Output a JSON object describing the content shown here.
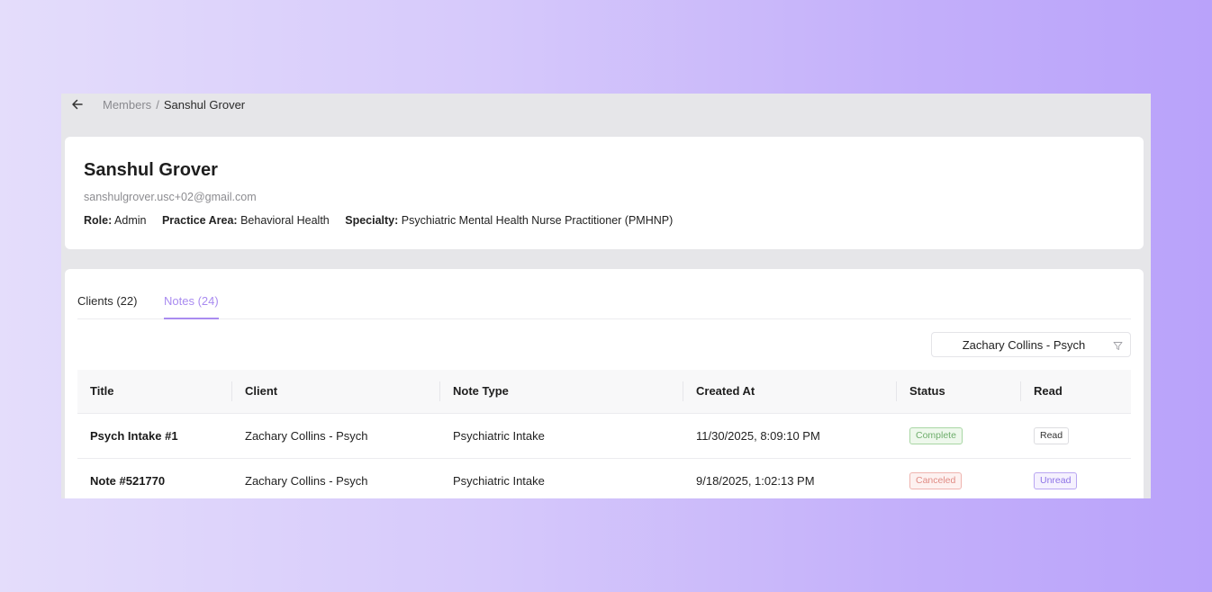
{
  "breadcrumb": {
    "back_icon": "arrow-left-icon",
    "parent": "Members",
    "separator": "/",
    "current": "Sanshul Grover"
  },
  "profile": {
    "name": "Sanshul Grover",
    "email": "sanshulgrover.usc+02@gmail.com",
    "role_label": "Role:",
    "role": "Admin",
    "practice_area_label": "Practice Area:",
    "practice_area": "Behavioral Health",
    "specialty_label": "Specialty:",
    "specialty": "Psychiatric Mental Health Nurse Practitioner (PMHNP)"
  },
  "tabs": [
    {
      "label": "Clients (22)",
      "active": false
    },
    {
      "label": "Notes (24)",
      "active": true
    }
  ],
  "filter": {
    "value": "Zachary Collins - Psych",
    "icon": "filter-icon"
  },
  "table": {
    "columns": [
      "Title",
      "Client",
      "Note Type",
      "Created At",
      "Status",
      "Read"
    ],
    "rows": [
      {
        "title": "Psych Intake #1",
        "client": "Zachary Collins - Psych",
        "note_type": "Psychiatric Intake",
        "created_at": "11/30/2025, 8:09:10 PM",
        "status": "Complete",
        "read": "Read"
      },
      {
        "title": "Note #521770",
        "client": "Zachary Collins - Psych",
        "note_type": "Psychiatric Intake",
        "created_at": "9/18/2025, 1:02:13 PM",
        "status": "Canceled",
        "read": "Unread"
      }
    ]
  },
  "colors": {
    "accent": "#a98bf0",
    "status_complete": "#6fae6c",
    "status_canceled": "#e08b84",
    "unread": "#8d72e6"
  }
}
